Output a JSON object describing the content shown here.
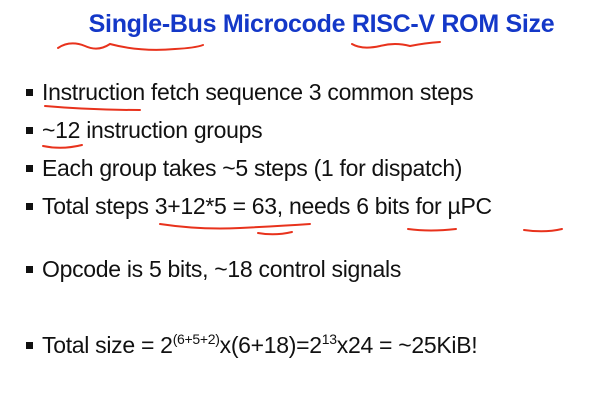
{
  "slide": {
    "title": "Single-Bus Microcode RISC-V ROM Size",
    "bullets": [
      "Instruction fetch sequence 3 common steps",
      "~12 instruction groups",
      "Each group takes ~5 steps (1 for dispatch)",
      "Total steps 3+12*5 = 63, needs 6 bits for µPC",
      "Opcode is 5 bits, ~18 control signals"
    ],
    "total": {
      "prefix": "Total size = 2",
      "exp1": "(6+5+2)",
      "mid": "x(6+18)=2",
      "exp2": "13",
      "suffix": "x24 = ~25KiB!"
    }
  },
  "colors": {
    "title": "#1438c8",
    "text": "#111111",
    "annotation": "#e8321c"
  }
}
